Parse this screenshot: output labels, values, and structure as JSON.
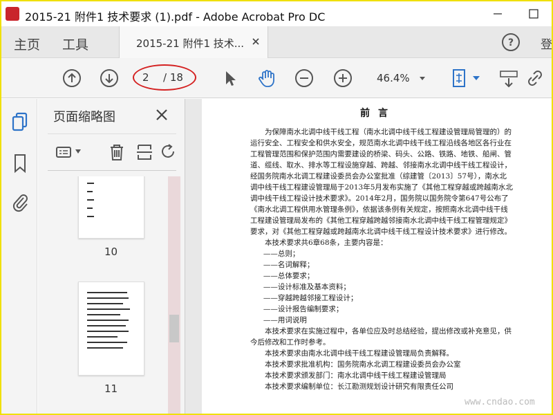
{
  "window": {
    "title": "2015-21 附件1 技术要求 (1).pdf - Adobe Acrobat Pro DC"
  },
  "tabs": {
    "home": "主页",
    "tools": "工具",
    "document": "2015-21 附件1 技术...",
    "signin": "登"
  },
  "toolbar": {
    "current_page": "2",
    "total_pages": "/ 18",
    "zoom": "46.4%"
  },
  "thumbnails_panel": {
    "title": "页面缩略图",
    "pages": [
      {
        "label": "10"
      },
      {
        "label": "11"
      }
    ]
  },
  "document": {
    "heading": "前言",
    "paragraphs": [
      "为保障南水北调中线干线工程（南水北调中线干线工程建设管理局管理的）的运行安全、工程安全和供水安全，规范南水北调中线干线工程沿线各地区各行业在工程管理范围和保护范围内需要建设的桥梁、码头、公路、铁路、地铁、船闸、管道、缆线、取水、排水等工程设施穿越、跨越、邻接南水北调中线干线工程设计，经国务院南水北调工程建设委员会办公室批准（综建管〔2013〕57号），南水北调中线干线工程建设管理局于2013年5月发布实施了《其他工程穿越或跨越南水北调中线干线工程设计技术要求》。2014年2月，国务院以国务院令第647号公布了《南水北调工程供用水管理条例》，依据该条例有关规定，按照南水北调中线干线工程建设管理局发布的《其他工程穿越跨越邻接南水北调中线干线工程管理规定》要求，对《其他工程穿越或跨越南水北调中线干线工程设计技术要求》进行修改。",
      "本技术要求共6章68条，主要内容是："
    ],
    "list": [
      "——总则；",
      "——名词解释；",
      "——总体要求；",
      "——设计标准及基本资料；",
      "——穿越跨越邻接工程设计；",
      "——设计报告编制要求；",
      "——用词说明"
    ],
    "closing": [
      "本技术要求在实施过程中，各单位应及时总结经验，提出修改或补充意见，供今后修改和工作时参考。",
      "本技术要求由南水北调中线干线工程建设管理局负责解释。",
      "本技术要求批准机构：国务院南水北调工程建设委员会办公室",
      "本技术要求颁发部门：南水北调中线干线工程建设管理局",
      "本技术要求编制单位：长江勘测规划设计研究有限责任公司"
    ]
  },
  "watermark": "www.cndao.com",
  "colors": {
    "highlight_oval": "#d42020",
    "toolbar_icon": "#555555",
    "active_icon": "#2d73c8"
  }
}
